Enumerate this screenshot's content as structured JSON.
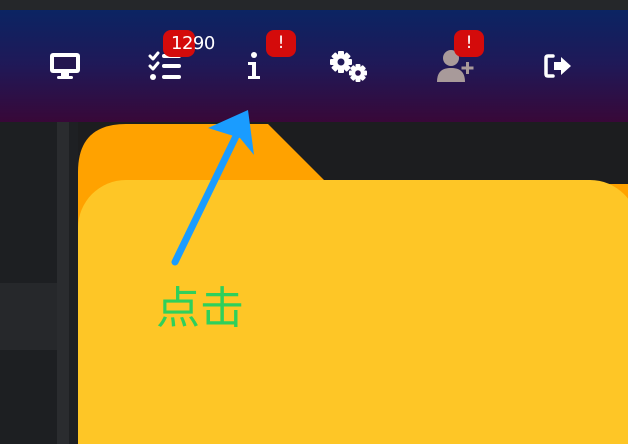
{
  "navbar": {
    "items": [
      {
        "icon": "desktop-icon"
      },
      {
        "icon": "tasks-icon",
        "badge": "1290"
      },
      {
        "icon": "info-icon",
        "badge": "!"
      },
      {
        "icon": "cogs-icon"
      },
      {
        "icon": "user-plus-icon",
        "badge": "!"
      },
      {
        "icon": "sign-out-icon"
      }
    ]
  },
  "annotation": {
    "label": "点击",
    "label_color": "#2fd05b",
    "arrow_color": "#1a9cff"
  },
  "colors": {
    "navbar_top": "#0b2463",
    "navbar_bottom": "#380838",
    "badge": "#d40b0b",
    "folder_back": "#ffa200",
    "folder_front": "#fec626",
    "background": "#1c1d1f"
  }
}
